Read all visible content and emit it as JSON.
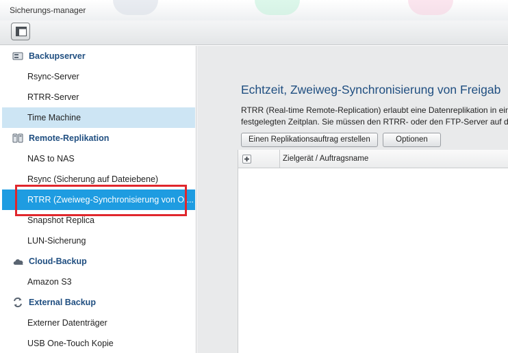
{
  "window": {
    "title": "Sicherungs-manager"
  },
  "toolbar": {
    "toggle_icon": "sidebar-toggle-icon"
  },
  "sidebar": {
    "groups": [
      {
        "label": "Backupserver",
        "icon": "server-icon",
        "items": [
          {
            "label": "Rsync-Server"
          },
          {
            "label": "RTRR-Server"
          },
          {
            "label": "Time Machine",
            "state": "highlighted"
          }
        ]
      },
      {
        "label": "Remote-Replikation",
        "icon": "replication-icon",
        "items": [
          {
            "label": "NAS to NAS"
          },
          {
            "label": "Rsync (Sicherung auf Dateiebene)"
          },
          {
            "label": "RTRR (Zweiweg-Synchronisierung von Or...",
            "state": "selected"
          },
          {
            "label": "Snapshot Replica"
          },
          {
            "label": "LUN-Sicherung"
          }
        ]
      },
      {
        "label": "Cloud-Backup",
        "icon": "cloud-icon",
        "items": [
          {
            "label": "Amazon S3"
          }
        ]
      },
      {
        "label": "External Backup",
        "icon": "sync-arrows-icon",
        "items": [
          {
            "label": "Externer Datenträger"
          },
          {
            "label": "USB One-Touch Kopie"
          }
        ]
      }
    ]
  },
  "main": {
    "heading": "Echtzeit, Zweiweg-Synchronisierung von Freigab",
    "description_line1": "RTRR (Real-time Remote-Replication) erlaubt eine Datenreplikation in ein",
    "description_line2": "festgelegten Zeitplan. Sie müssen den RTRR- oder den FTP-Server auf de",
    "buttons": {
      "create_job": "Einen Replikationsauftrag erstellen",
      "options": "Optionen"
    },
    "table": {
      "column_target": "Zielgerät / Auftragsname"
    }
  },
  "colors": {
    "accent": "#1e9ce1",
    "highlight": "#cde5f4",
    "heading": "#1f4e80",
    "annotation_box": "#e0262c"
  }
}
